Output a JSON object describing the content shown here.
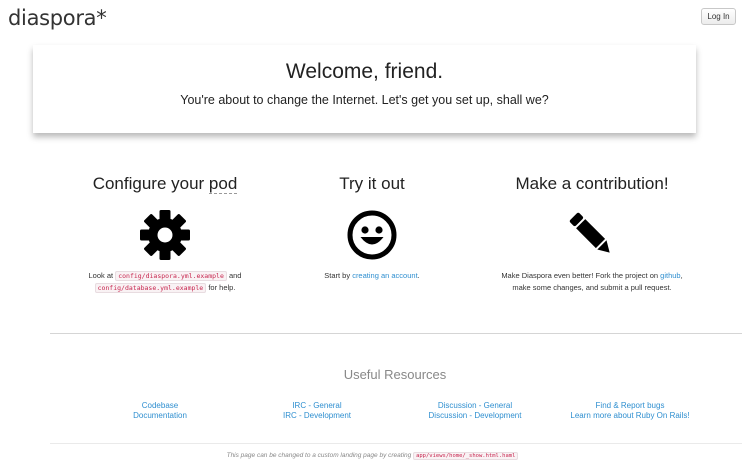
{
  "header": {
    "logo": "diaspora*",
    "login_label": "Log In"
  },
  "welcome": {
    "title": "Welcome, friend.",
    "subtitle": "You're about to change the Internet. Let's get you set up, shall we?"
  },
  "columns": [
    {
      "title_prefix": "Configure your ",
      "title_underlined": "pod",
      "icon": "gear-icon",
      "text_before": "Look at ",
      "code_1": "config/diaspora.yml.example",
      "text_mid": " and",
      "code_2": "config/database.yml.example",
      "text_after": " for help."
    },
    {
      "title": "Try it out",
      "icon": "smiley-icon",
      "text_before": "Start by ",
      "link": "creating an account",
      "text_after": "."
    },
    {
      "title": "Make a contribution!",
      "icon": "pencil-icon",
      "text_before": "Make Diaspora even better! Fork the project on ",
      "link": "github",
      "text_after": ",",
      "text_line2": "make some changes, and submit a pull request."
    }
  ],
  "resources": {
    "title": "Useful Resources",
    "groups": [
      [
        "Codebase",
        "Documentation"
      ],
      [
        "IRC - General",
        "IRC - Development"
      ],
      [
        "Discussion - General",
        "Discussion - Development"
      ],
      [
        "Find & Report bugs",
        "Learn more about Ruby On Rails!"
      ]
    ]
  },
  "footer": {
    "text": "This page can be changed to a custom landing page by creating",
    "code": "app/views/home/_show.html.haml"
  }
}
